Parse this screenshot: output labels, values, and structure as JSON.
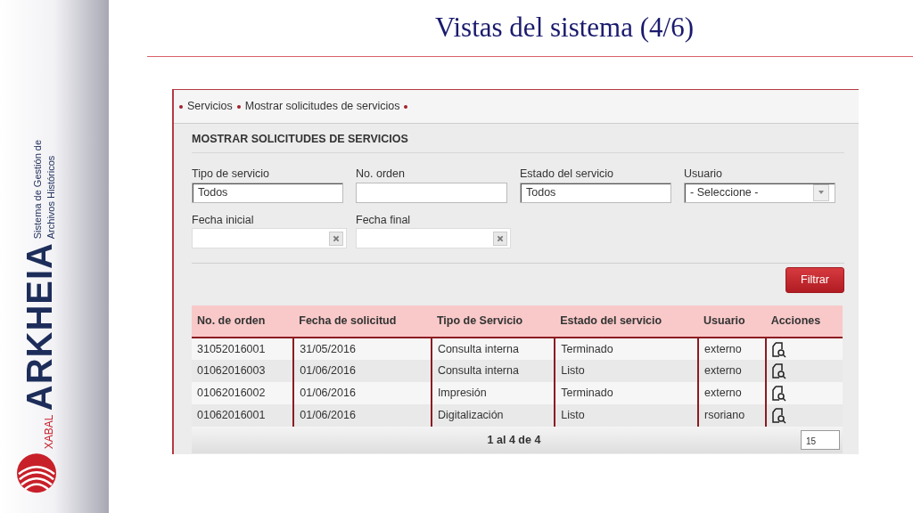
{
  "slide": {
    "title": "Vistas del sistema (4/6)"
  },
  "brand": {
    "company": "XABAL",
    "product": "ARKHEIA",
    "tagline_lines": [
      "Sistema de Gestión de",
      "Archivos Históricos"
    ]
  },
  "breadcrumb": [
    "Servicios",
    "Mostrar solicitudes de servicios"
  ],
  "form": {
    "heading": "MOSTRAR SOLICITUDES DE SERVICIOS",
    "fields": [
      {
        "label": "Tipo de servicio",
        "kind": "text",
        "value": "Todos"
      },
      {
        "label": "No. orden",
        "kind": "text"
      },
      {
        "label": "Estado del servicio",
        "kind": "text",
        "value": "Todos"
      },
      {
        "label": "Usuario",
        "kind": "select",
        "value": "- Seleccione -"
      },
      {
        "label": "Fecha inicial",
        "kind": "date"
      },
      {
        "label": "Fecha final",
        "kind": "date"
      }
    ],
    "submit": "Filtrar"
  },
  "table": {
    "columns": [
      "No. de orden",
      "Fecha de solicitud",
      "Tipo de Servicio",
      "Estado del servicio",
      "Usuario",
      "Acciones"
    ],
    "rows": [
      [
        "31052016001",
        "31/05/2016",
        "Consulta interna",
        "Terminado",
        "externo"
      ],
      [
        "01062016003",
        "01/06/2016",
        "Consulta interna",
        "Listo",
        "externo"
      ],
      [
        "01062016002",
        "01/06/2016",
        "Impresión",
        "Terminado",
        "externo"
      ],
      [
        "01062016001",
        "01/06/2016",
        "Digitalización",
        "Listo",
        "rsoriano"
      ]
    ],
    "pager": "1 al 4 de 4",
    "page_size": "15"
  }
}
